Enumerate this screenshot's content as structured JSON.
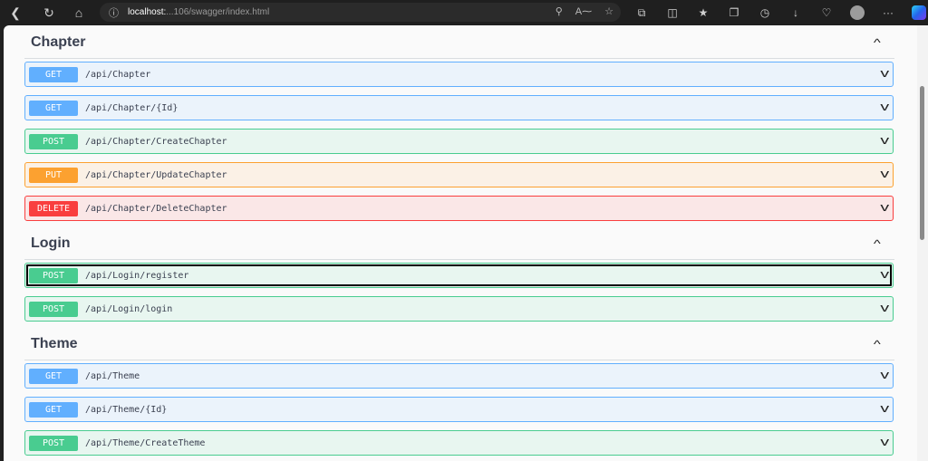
{
  "browser": {
    "url_host": "localhost:",
    "url_rest": "...106/swagger/index.html",
    "icons": [
      "back-icon",
      "refresh-icon",
      "home-icon",
      "site-info-icon",
      "zoom-icon",
      "read-aloud-icon",
      "favorite-icon",
      "extensions-icon",
      "split-screen-icon",
      "favorites-bar-icon",
      "collections-icon",
      "history-icon",
      "downloads-icon",
      "performance-icon",
      "profile-avatar",
      "more-icon",
      "copilot-icon"
    ],
    "more_label": "···"
  },
  "sections": [
    {
      "title": "Chapter",
      "operations": [
        {
          "method": "GET",
          "path": "/api/Chapter",
          "kind": "get"
        },
        {
          "method": "GET",
          "path": "/api/Chapter/{Id}",
          "kind": "get"
        },
        {
          "method": "POST",
          "path": "/api/Chapter/CreateChapter",
          "kind": "post"
        },
        {
          "method": "PUT",
          "path": "/api/Chapter/UpdateChapter",
          "kind": "put"
        },
        {
          "method": "DELETE",
          "path": "/api/Chapter/DeleteChapter",
          "kind": "delete"
        }
      ]
    },
    {
      "title": "Login",
      "operations": [
        {
          "method": "POST",
          "path": "/api/Login/register",
          "kind": "post",
          "focused": true
        },
        {
          "method": "POST",
          "path": "/api/Login/login",
          "kind": "post"
        }
      ]
    },
    {
      "title": "Theme",
      "operations": [
        {
          "method": "GET",
          "path": "/api/Theme",
          "kind": "get"
        },
        {
          "method": "GET",
          "path": "/api/Theme/{Id}",
          "kind": "get"
        },
        {
          "method": "POST",
          "path": "/api/Theme/CreateTheme",
          "kind": "post"
        }
      ]
    }
  ],
  "colors": {
    "get": "#61affe",
    "post": "#49cc90",
    "put": "#fca130",
    "delete": "#f93e3e"
  }
}
